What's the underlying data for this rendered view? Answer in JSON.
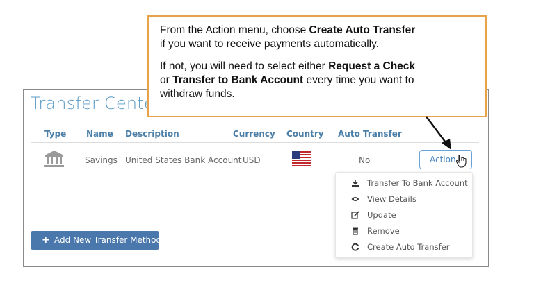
{
  "panel": {
    "title": "Transfer Center"
  },
  "table": {
    "headers": [
      "Type",
      "Name",
      "Description",
      "Currency",
      "Country",
      "Auto Transfer"
    ],
    "row": {
      "type_icon": "bank-icon",
      "name": "Savings",
      "description": "United States Bank Account",
      "currency": "USD",
      "country_icon": "us-flag-icon",
      "auto_transfer": "No",
      "action_label": "Action"
    }
  },
  "menu": {
    "items": [
      {
        "icon": "download-icon",
        "label": "Transfer To Bank Account"
      },
      {
        "icon": "eye-icon",
        "label": "View Details"
      },
      {
        "icon": "edit-icon",
        "label": "Update"
      },
      {
        "icon": "trash-icon",
        "label": "Remove"
      },
      {
        "icon": "refresh-icon",
        "label": "Create Auto Transfer"
      }
    ]
  },
  "add_button": {
    "icon": "plus-icon",
    "label": "Add New Transfer Method"
  },
  "callout": {
    "p1_a": "From the Action menu, choose ",
    "p1_b": "Create Auto Transfer",
    "p1_c": "if you want to receive payments automatically.",
    "p2_a": "If not, you will need to select either ",
    "p2_b": "Request a Check",
    "p2_c": "or ",
    "p2_d": "Transfer to Bank Account",
    "p2_e": " every time you want to",
    "p2_f": "withdraw funds."
  },
  "colors": {
    "title": "#5b9bc7",
    "header": "#4b7fa8",
    "button": "#4a78ad",
    "callout_border": "#e8a34a"
  }
}
